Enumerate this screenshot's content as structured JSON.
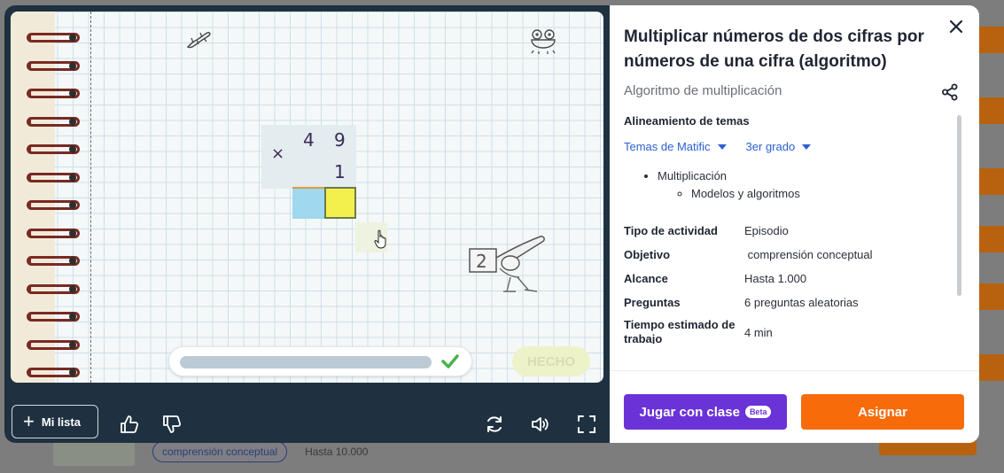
{
  "background": {
    "row_pill": "comprensión conceptual",
    "row_range": "Hasta 10.000"
  },
  "game": {
    "multiplication": {
      "sign": "×",
      "top_tens": "4",
      "top_units": "9",
      "bottom_units": "1"
    },
    "done_label": "HECHO",
    "progress": 0,
    "toolbar": {
      "mylist_label": "Mi lista"
    }
  },
  "info": {
    "title": "Multiplicar números de dos cifras por números de una cifra (algoritmo)",
    "subtitle": "Algoritmo de multiplicación",
    "alignment_title": "Alineamiento de temas",
    "dropdowns": {
      "curriculum": "Temas de Matific",
      "grade": "3er grado"
    },
    "topics": {
      "main": "Multiplicación",
      "sub": "Modelos y algoritmos"
    },
    "details": [
      {
        "key": "Tipo de actividad",
        "value": "Episodio"
      },
      {
        "key": "Objetivo",
        "value": " comprensión conceptual"
      },
      {
        "key": "Alcance",
        "value": "Hasta 1.000"
      },
      {
        "key": "Preguntas",
        "value": "6 preguntas aleatorias"
      },
      {
        "key": "Tiempo estimado de trabajo",
        "value": "4 min"
      }
    ],
    "play_label": "Jugar con clase",
    "beta_label": "Beta",
    "assign_label": "Asignar"
  },
  "colors": {
    "accent_purple": "#6a33d8",
    "accent_orange": "#f76b0a",
    "link_blue": "#2c5fd1"
  },
  "icons": [
    "close-icon",
    "share-icon",
    "plus-icon",
    "thumbs-up-icon",
    "thumbs-down-icon",
    "refresh-icon",
    "volume-icon",
    "fullscreen-icon",
    "check-icon",
    "hand-cursor-icon"
  ]
}
